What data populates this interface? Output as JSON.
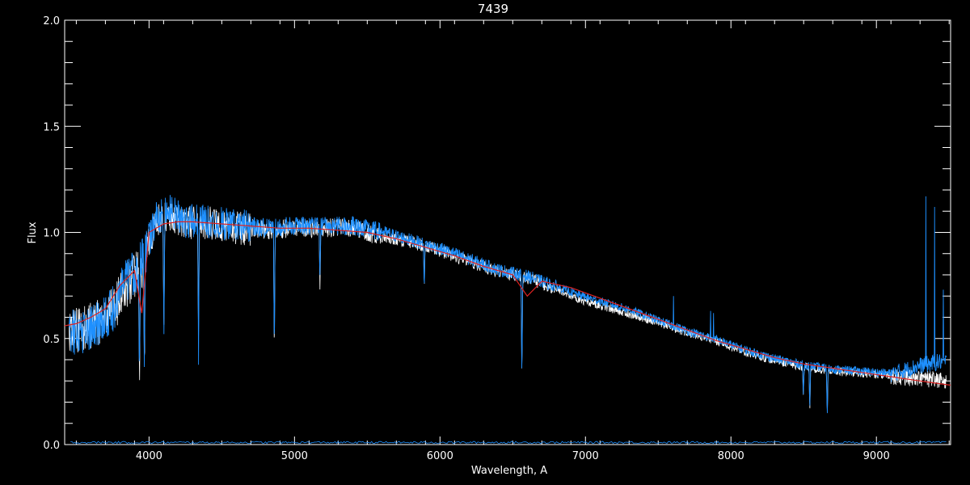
{
  "chart_data": {
    "type": "line",
    "title": "7439",
    "xlabel": "Wavelength, A",
    "ylabel": "Flux",
    "xlim": [
      3420,
      9510
    ],
    "ylim": [
      0.0,
      2.0
    ],
    "x_ticks": [
      4000,
      5000,
      6000,
      7000,
      8000,
      9000
    ],
    "x_tick_labels": [
      "4000",
      "5000",
      "6000",
      "7000",
      "8000",
      "9000"
    ],
    "y_ticks": [
      0.0,
      0.5,
      1.0,
      1.5,
      2.0
    ],
    "y_tick_labels": [
      "0.0",
      "0.5",
      "1.0",
      "1.5",
      "2.0"
    ],
    "background": "#000000",
    "axis_color": "#ffffff",
    "series": [
      {
        "role": "observed-white",
        "color": "#ffffff",
        "x": [
          3450,
          3550,
          3650,
          3750,
          3850,
          3950,
          4050,
          4150,
          4250,
          4400,
          4600,
          4800,
          5000,
          5200,
          5400,
          5600,
          5800,
          6000,
          6200,
          6400,
          6600,
          6800,
          6950,
          7100,
          7300,
          7500,
          7700,
          7900,
          8100,
          8300,
          8500,
          8700,
          8900,
          9100,
          9300,
          9450
        ],
        "y": [
          0.56,
          0.57,
          0.6,
          0.65,
          0.78,
          0.85,
          1.07,
          1.1,
          1.06,
          1.06,
          1.04,
          1.02,
          1.03,
          1.03,
          1.03,
          0.99,
          0.96,
          0.92,
          0.87,
          0.82,
          0.79,
          0.74,
          0.69,
          0.66,
          0.62,
          0.58,
          0.53,
          0.49,
          0.44,
          0.4,
          0.37,
          0.35,
          0.34,
          0.33,
          0.32,
          0.31
        ]
      },
      {
        "role": "observed-blue",
        "color": "#1e90ff",
        "x": [
          3450,
          3550,
          3650,
          3750,
          3850,
          3950,
          4050,
          4150,
          4250,
          4400,
          4600,
          4800,
          5000,
          5200,
          5400,
          5600,
          5800,
          6000,
          6200,
          6400,
          6600,
          6800,
          6950,
          7100,
          7300,
          7500,
          7700,
          7900,
          8100,
          8300,
          8500,
          8700,
          8900,
          9100,
          9300,
          9450
        ],
        "y": [
          0.55,
          0.56,
          0.59,
          0.66,
          0.8,
          0.88,
          1.08,
          1.12,
          1.07,
          1.07,
          1.05,
          1.03,
          1.04,
          1.04,
          1.04,
          1.01,
          0.97,
          0.93,
          0.88,
          0.83,
          0.8,
          0.75,
          0.71,
          0.68,
          0.64,
          0.59,
          0.54,
          0.5,
          0.45,
          0.41,
          0.38,
          0.36,
          0.35,
          0.34,
          0.38,
          0.4
        ]
      },
      {
        "role": "model-fit",
        "color": "#dd2222",
        "x": [
          3420,
          3500,
          3600,
          3700,
          3800,
          3900,
          3950,
          4000,
          4100,
          4200,
          4300,
          4500,
          4700,
          4900,
          5100,
          5300,
          5500,
          5700,
          5900,
          6100,
          6300,
          6500,
          6600,
          6700,
          6900,
          7100,
          7300,
          7500,
          7700,
          7900,
          8100,
          8300,
          8500,
          8700,
          8900,
          9100,
          9300,
          9510
        ],
        "y": [
          0.56,
          0.57,
          0.6,
          0.64,
          0.75,
          0.82,
          0.62,
          1.0,
          1.04,
          1.05,
          1.05,
          1.04,
          1.03,
          1.02,
          1.02,
          1.01,
          1.0,
          0.97,
          0.93,
          0.89,
          0.84,
          0.8,
          0.7,
          0.77,
          0.74,
          0.69,
          0.64,
          0.59,
          0.54,
          0.49,
          0.45,
          0.41,
          0.38,
          0.36,
          0.34,
          0.32,
          0.3,
          0.28
        ]
      }
    ],
    "absorption_lines": [
      {
        "x": 3934,
        "depth": 0.55
      },
      {
        "x": 3968,
        "depth": 0.5
      },
      {
        "x": 4102,
        "depth": 0.55
      },
      {
        "x": 4340,
        "depth": 0.6
      },
      {
        "x": 4861,
        "depth": 0.58
      },
      {
        "x": 5175,
        "depth": 0.25
      },
      {
        "x": 5892,
        "depth": 0.2
      },
      {
        "x": 6563,
        "depth": 0.5
      },
      {
        "x": 8498,
        "depth": 0.15
      },
      {
        "x": 8542,
        "depth": 0.22
      },
      {
        "x": 8662,
        "depth": 0.22
      }
    ],
    "emission_spikes": [
      {
        "x": 7605,
        "height": 0.7
      },
      {
        "x": 7860,
        "height": 0.63
      },
      {
        "x": 7880,
        "height": 0.62
      },
      {
        "x": 9340,
        "height": 1.17
      },
      {
        "x": 9400,
        "height": 1.12
      },
      {
        "x": 9460,
        "height": 0.73
      }
    ]
  }
}
